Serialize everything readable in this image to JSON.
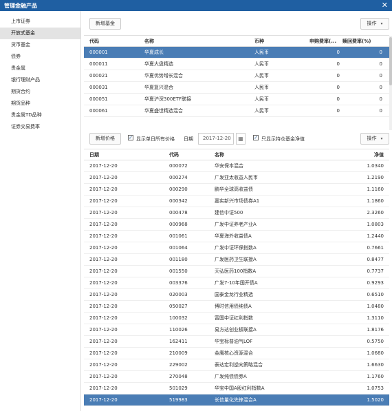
{
  "window": {
    "title": "管理金融产品",
    "close_glyph": "✕"
  },
  "sidebar": {
    "items": [
      {
        "label": "上市证券",
        "active": false
      },
      {
        "label": "开放式基金",
        "active": true
      },
      {
        "label": "货币基金",
        "active": false
      },
      {
        "label": "债券",
        "active": false
      },
      {
        "label": "贵金属",
        "active": false
      },
      {
        "label": "银行理财产品",
        "active": false
      },
      {
        "label": "期货合约",
        "active": false
      },
      {
        "label": "期货品种",
        "active": false
      },
      {
        "label": "贵金属TD品种",
        "active": false
      },
      {
        "label": "证券交易费率",
        "active": false
      }
    ]
  },
  "fund_toolbar": {
    "add_label": "新增基金",
    "ops_label": "操作"
  },
  "fund_table": {
    "columns": [
      "代码",
      "名称",
      "币种",
      "申购费率(...",
      "赎回费率(%)"
    ],
    "rows": [
      [
        "000001",
        "华夏成长",
        "人民币",
        "0",
        "0"
      ],
      [
        "000011",
        "华夏大盘精选",
        "人民币",
        "0",
        "0"
      ],
      [
        "000021",
        "华夏优势增长混合",
        "人民币",
        "0",
        "0"
      ],
      [
        "000031",
        "华夏复兴混合",
        "人民币",
        "0",
        "0"
      ],
      [
        "000051",
        "华夏沪深300ETF联接",
        "人民币",
        "0",
        "0"
      ],
      [
        "000061",
        "华夏盛世精选混合",
        "人民币",
        "0",
        "0"
      ]
    ],
    "selected_index": 0
  },
  "nav_toolbar": {
    "add_label": "新增价格",
    "show_all_label": "显示单日所有价格",
    "show_all_checked": true,
    "date_label": "日期",
    "date_value": "2017-12-20",
    "held_only_label": "只显示持仓基金净值",
    "held_only_checked": true,
    "ops_label": "操作",
    "check_glyph": "✓",
    "calendar_icon": "calendar-icon",
    "caret_icon": "chevron-down-icon"
  },
  "nav_table": {
    "columns": [
      "日期",
      "代码",
      "名称",
      "净值"
    ],
    "rows": [
      [
        "2017-12-20",
        "000072",
        "华安保本混合",
        "1.0340"
      ],
      [
        "2017-12-20",
        "000274",
        "广发亚太收益人民币",
        "1.2190"
      ],
      [
        "2017-12-20",
        "000290",
        "鹏华全球高收益债",
        "1.1160"
      ],
      [
        "2017-12-20",
        "000342",
        "嘉实新兴市场债券A1",
        "1.1860"
      ],
      [
        "2017-12-20",
        "000478",
        "建信中证500",
        "2.3260"
      ],
      [
        "2017-12-20",
        "000968",
        "广发中证养老产业A",
        "1.0803"
      ],
      [
        "2017-12-20",
        "001061",
        "华夏海外收益债A",
        "1.2440"
      ],
      [
        "2017-12-20",
        "001064",
        "广发中证环保指数A",
        "0.7661"
      ],
      [
        "2017-12-20",
        "001180",
        "广发医药卫生联接A",
        "0.8477"
      ],
      [
        "2017-12-20",
        "001550",
        "天弘医药100指数A",
        "0.7737"
      ],
      [
        "2017-12-20",
        "003376",
        "广发7-10年国开债A",
        "0.9293"
      ],
      [
        "2017-12-20",
        "020003",
        "国泰金龙行业精选",
        "0.6510"
      ],
      [
        "2017-12-20",
        "050027",
        "博时信用债纯债A",
        "1.0480"
      ],
      [
        "2017-12-20",
        "100032",
        "富国中证红利指数",
        "1.3110"
      ],
      [
        "2017-12-20",
        "110026",
        "易方达创业板联接A",
        "1.8176"
      ],
      [
        "2017-12-20",
        "162411",
        "华宝标普油气LOF",
        "0.5750"
      ],
      [
        "2017-12-20",
        "210009",
        "金鹰核心资源混合",
        "1.0680"
      ],
      [
        "2017-12-20",
        "229002",
        "泰达宏利逆向策略混合",
        "1.6630"
      ],
      [
        "2017-12-20",
        "270048",
        "广发纯债债券A",
        "1.1760"
      ],
      [
        "2017-12-20",
        "501029",
        "华宝中国A股红利指数A",
        "1.0753"
      ],
      [
        "2017-12-20",
        "519983",
        "长信量化先锋混合A",
        "1.5020"
      ]
    ],
    "selected_index": 20
  }
}
